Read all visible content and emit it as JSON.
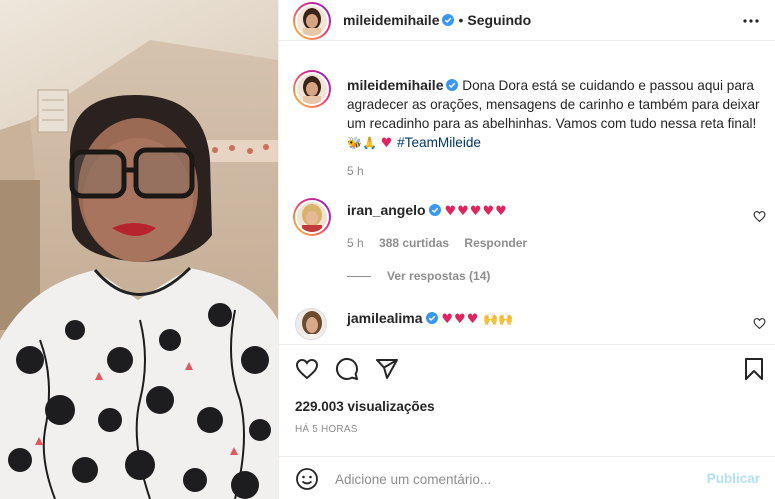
{
  "post": {
    "author": "mileidemihaile",
    "separator": "•",
    "follow_status": "Seguindo",
    "caption": "Dona Dora está se cuidando e passou aqui para agradecer as orações, mensagens de carinho e também para deixar um recadinho para as abelhinhas. Vamos com tudo nessa reta final!",
    "caption_emojis": "🐝🙏",
    "caption_heart": "♥",
    "hashtag": "#TeamMileide",
    "caption_time": "5 h",
    "views": "229.003 visualizações",
    "posted_ago": "HÁ 5 HORAS"
  },
  "comments": [
    {
      "user": "iran_angelo",
      "text": "♥♥♥♥♥",
      "time": "5 h",
      "likes": "388 curtidas",
      "reply_label": "Responder",
      "view_replies": "Ver respostas (14)"
    },
    {
      "user": "jamilealima",
      "text": "♥♥♥",
      "extra_emojis": "🙌🙌"
    }
  ],
  "composer": {
    "placeholder": "Adicione um comentário...",
    "publish_label": "Publicar"
  },
  "icons": {
    "more": "more-horizontal-icon",
    "like": "heart-icon",
    "comment": "comment-icon",
    "share": "share-icon",
    "save": "bookmark-icon",
    "emoji": "emoji-icon",
    "verified": "verified-badge-icon"
  },
  "colors": {
    "link": "#00376b",
    "heart": "#e0245e",
    "verified": "#3897f0",
    "publish_disabled": "#b2dffc",
    "muted": "#8e8e8e"
  }
}
